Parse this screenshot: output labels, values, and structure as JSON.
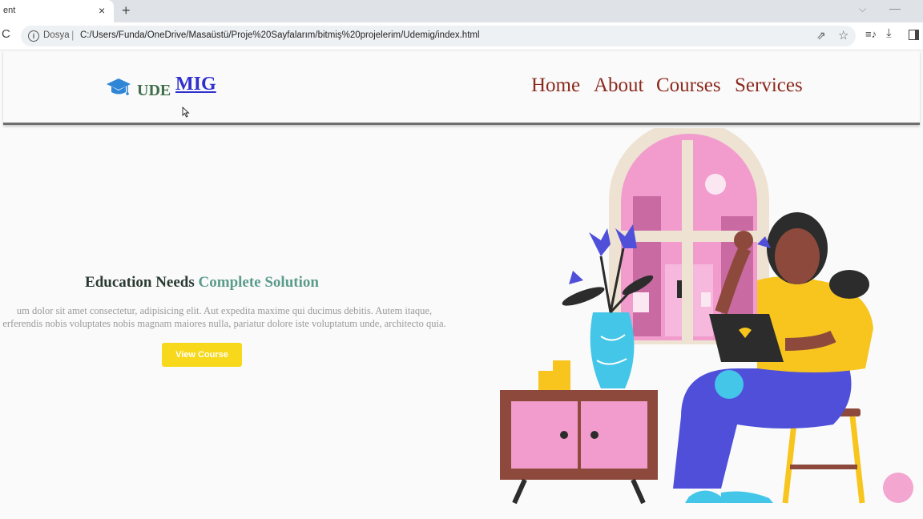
{
  "browser": {
    "tab_title": "ent",
    "tab_close_icon": "×",
    "new_tab_icon": "+",
    "tab_dropdown_icon": "⌵",
    "minimize_icon": "—",
    "reload_icon": "C",
    "info_icon": "i",
    "site_label": "Dosya",
    "url_separator": "|",
    "url": "C:/Users/Funda/OneDrive/Masaüstü/Proje%20Sayfalarım/bitmiş%20projelerim/Udemig/index.html",
    "share_icon": "⇗",
    "star_icon": "☆",
    "media_icon": "≡♪",
    "download_icon": "⤓"
  },
  "nav": {
    "logo_prefix": "UDE",
    "logo_link": "MIG",
    "links": [
      "Home",
      "About",
      "Courses",
      "Services"
    ]
  },
  "hero": {
    "headline_part1": "Education Needs",
    "headline_part2": "Complete Solution",
    "paragraph_line1": "um dolor sit amet consectetur, adipisicing elit. Aut expedita maxime qui ducimus debitis. Autem itaque,",
    "paragraph_line2": "erferendis nobis voluptates nobis magnam maiores nulla, pariatur dolore iste voluptatum unde, architecto quia.",
    "cta_label": "View Course"
  },
  "colors": {
    "accent": "#5b9b8c",
    "nav_link": "#8b2a1e",
    "cta": "#f7d81a",
    "fab": "#f3a6cf"
  }
}
